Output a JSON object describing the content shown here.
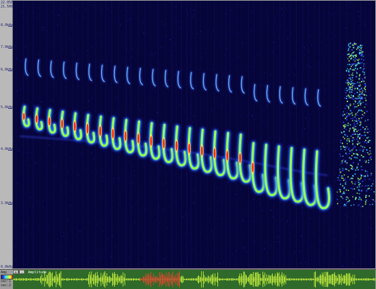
{
  "axis": {
    "top_values": [
      "22.050k",
      "21.500k"
    ],
    "ticks": [
      "8.0kHz",
      "7.0kHz",
      "6.0kHz",
      "5.0kHz",
      "4.0kHz",
      "3.0kHz"
    ],
    "bottom_value": "0.0kHz"
  },
  "waveform": {
    "label": "Amplitude",
    "side_labels": [
      "Amp",
      "sec:1",
      "sec:2"
    ]
  },
  "colors": {
    "background": "#06053a",
    "colormap": [
      "#101060",
      "#3050ff",
      "#40e0ff",
      "#80ff60",
      "#ffff40",
      "#ff3020"
    ],
    "wave": "#d8ff40",
    "wave_highlight": "#ff3030"
  }
}
